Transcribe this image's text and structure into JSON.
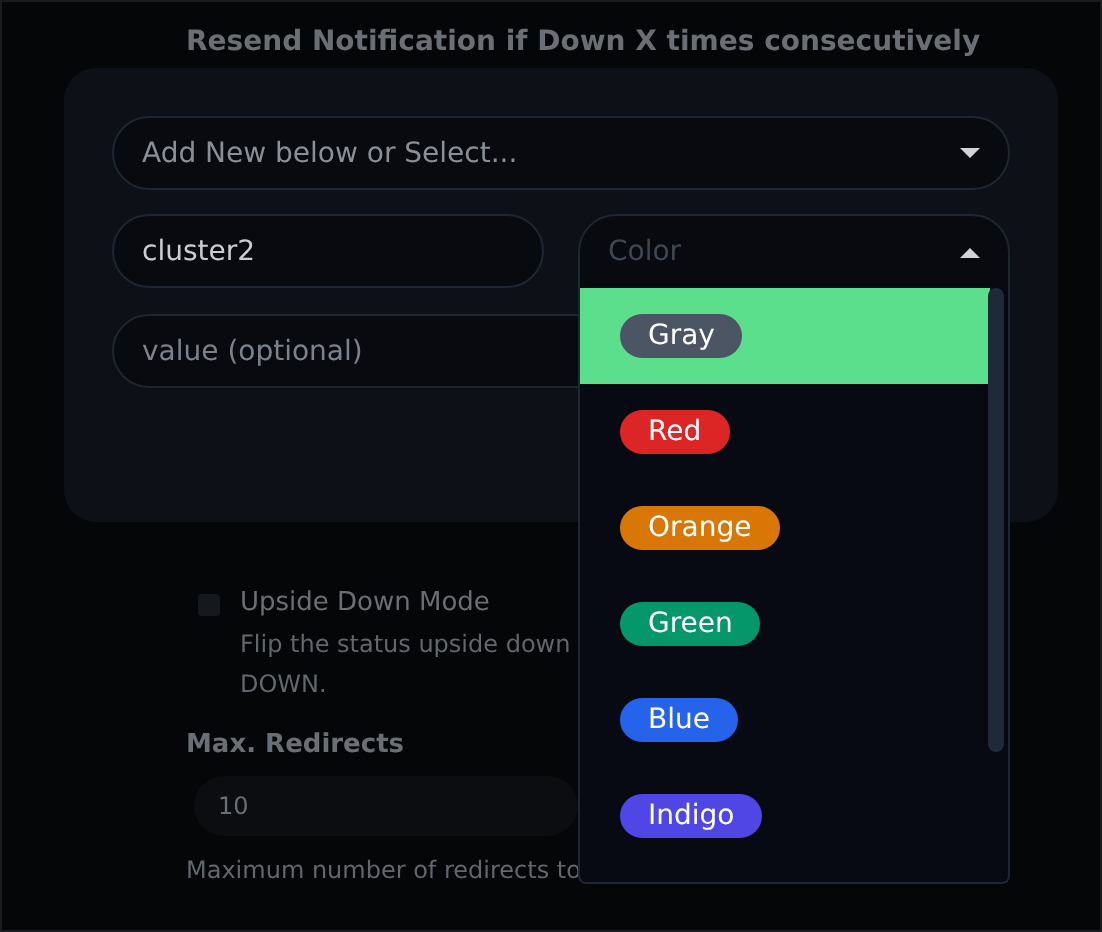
{
  "background": {
    "heading": "Resend Notification if Down X times consecutively",
    "option": {
      "label": "Upside Down Mode",
      "checked": false,
      "description": "Flip the status upside down",
      "description_end": "DOWN."
    },
    "max_redirects": {
      "label": "Max. Redirects",
      "value": "10",
      "help": "Maximum number of redirects to"
    }
  },
  "modal": {
    "select": {
      "placeholder": "Add New below or Select..."
    },
    "name": {
      "value": "cluster2"
    },
    "value": {
      "placeholder": "value (optional)"
    },
    "color": {
      "placeholder": "Color",
      "expanded": true,
      "options": [
        {
          "label": "Gray",
          "color": "#4b5563",
          "selected": true
        },
        {
          "label": "Red",
          "color": "#dc2626",
          "selected": false
        },
        {
          "label": "Orange",
          "color": "#d97706",
          "selected": false
        },
        {
          "label": "Green",
          "color": "#059669",
          "selected": false
        },
        {
          "label": "Blue",
          "color": "#2563eb",
          "selected": false
        },
        {
          "label": "Indigo",
          "color": "#4f46e5",
          "selected": false
        }
      ]
    }
  }
}
